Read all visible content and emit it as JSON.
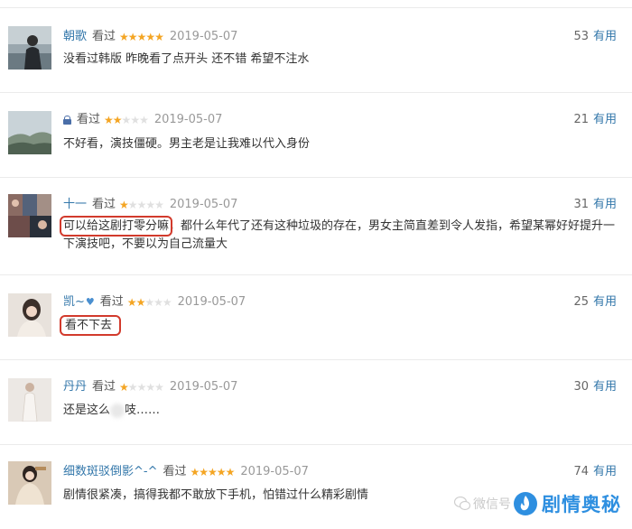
{
  "colors": {
    "username": "#3377aa",
    "star": "#f4a523",
    "highlight_box": "#d23a2c",
    "watermark": "#2e8fe0"
  },
  "reviews": [
    {
      "user": "朝歌",
      "status": "看过",
      "rating": 5,
      "date": "2019-05-07",
      "votes": "53",
      "useful": "有用",
      "content": "没看过韩版 昨晚看了点开头 还不错 希望不注水",
      "avatar_icon": "person-photo-icon"
    },
    {
      "user": "",
      "status": "看过",
      "rating": 2,
      "date": "2019-05-07",
      "votes": "21",
      "useful": "有用",
      "content": "不好看，演技僵硬。男主老是让我难以代入身份",
      "avatar_icon": "landscape-photo-icon",
      "lock_icon": "lock-icon"
    },
    {
      "user": "十一",
      "status": "看过",
      "rating": 1,
      "date": "2019-05-07",
      "votes": "31",
      "useful": "有用",
      "content_highlight": "可以给这剧打零分嘛",
      "content_rest": "，都什么年代了还有这种垃圾的存在，男女主简直差到令人发指，希望某幂好好提升一下演技吧，不要以为自己流量大",
      "avatar_icon": "collage-photo-icon"
    },
    {
      "user": "凯~",
      "status": "看过",
      "rating": 2,
      "date": "2019-05-07",
      "votes": "25",
      "useful": "有用",
      "content_highlight": "看不下去",
      "avatar_icon": "girl-photo-icon",
      "badge_icon": "heart-icon"
    },
    {
      "user": "丹丹",
      "status": "看过",
      "rating": 1,
      "date": "2019-05-07",
      "votes": "30",
      "useful": "有用",
      "content_before": "还是这么",
      "content_after": "吱……",
      "avatar_icon": "dress-photo-icon"
    },
    {
      "user": "细数斑驳倒影^-^",
      "status": "看过",
      "rating": 5,
      "date": "2019-05-07",
      "votes": "74",
      "useful": "有用",
      "content": "剧情很紧凑，搞得我都不敢放下手机，怕错过什么精彩剧情",
      "avatar_icon": "costume-photo-icon"
    }
  ],
  "watermark": {
    "prefix": "微信号",
    "name": "剧情奥秘",
    "logo_icon": "flame-logo-icon"
  }
}
